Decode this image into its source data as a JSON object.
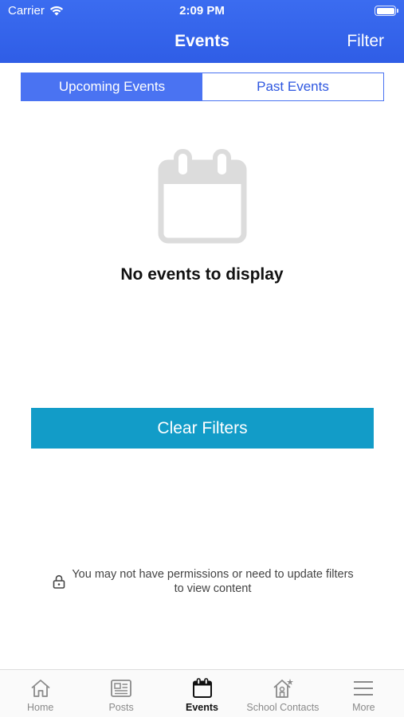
{
  "status_bar": {
    "carrier": "Carrier",
    "time": "2:09 PM"
  },
  "header": {
    "title": "Events",
    "filter_label": "Filter"
  },
  "segments": {
    "upcoming": "Upcoming Events",
    "past": "Past Events",
    "selected": "Upcoming Events"
  },
  "empty_state": {
    "icon": "calendar-icon",
    "message": "No events to display"
  },
  "clear_filters_label": "Clear Filters",
  "permission_note": {
    "icon": "lock-icon",
    "line1": "You may not have permissions or need to update filters",
    "line2": "to view content"
  },
  "tabs": [
    {
      "label": "Home",
      "icon": "home-icon"
    },
    {
      "label": "Posts",
      "icon": "posts-icon"
    },
    {
      "label": "Events",
      "icon": "calendar-icon",
      "active": true
    },
    {
      "label": "School Contacts",
      "icon": "school-contacts-icon"
    },
    {
      "label": "More",
      "icon": "menu-icon"
    }
  ],
  "colors": {
    "header": "#2f5de6",
    "segment_accent": "#4a73f2",
    "button": "#129cc8"
  }
}
